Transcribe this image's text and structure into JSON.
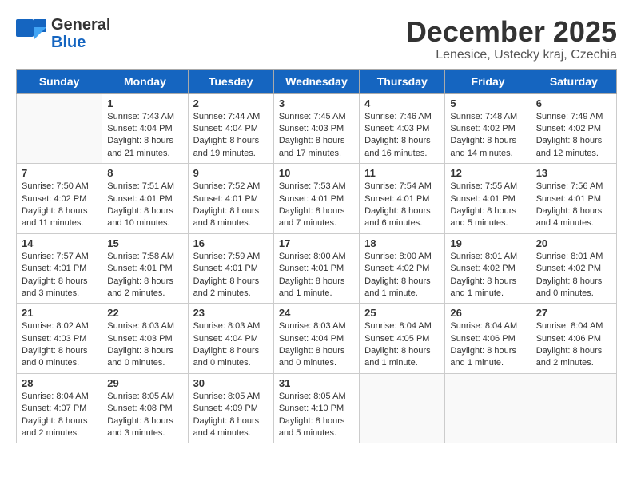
{
  "header": {
    "logo_general": "General",
    "logo_blue": "Blue",
    "month_title": "December 2025",
    "location": "Lenesice, Ustecky kraj, Czechia"
  },
  "weekdays": [
    "Sunday",
    "Monday",
    "Tuesday",
    "Wednesday",
    "Thursday",
    "Friday",
    "Saturday"
  ],
  "weeks": [
    [
      {
        "day": "",
        "content": ""
      },
      {
        "day": "1",
        "content": "Sunrise: 7:43 AM\nSunset: 4:04 PM\nDaylight: 8 hours\nand 21 minutes."
      },
      {
        "day": "2",
        "content": "Sunrise: 7:44 AM\nSunset: 4:04 PM\nDaylight: 8 hours\nand 19 minutes."
      },
      {
        "day": "3",
        "content": "Sunrise: 7:45 AM\nSunset: 4:03 PM\nDaylight: 8 hours\nand 17 minutes."
      },
      {
        "day": "4",
        "content": "Sunrise: 7:46 AM\nSunset: 4:03 PM\nDaylight: 8 hours\nand 16 minutes."
      },
      {
        "day": "5",
        "content": "Sunrise: 7:48 AM\nSunset: 4:02 PM\nDaylight: 8 hours\nand 14 minutes."
      },
      {
        "day": "6",
        "content": "Sunrise: 7:49 AM\nSunset: 4:02 PM\nDaylight: 8 hours\nand 12 minutes."
      }
    ],
    [
      {
        "day": "7",
        "content": "Sunrise: 7:50 AM\nSunset: 4:02 PM\nDaylight: 8 hours\nand 11 minutes."
      },
      {
        "day": "8",
        "content": "Sunrise: 7:51 AM\nSunset: 4:01 PM\nDaylight: 8 hours\nand 10 minutes."
      },
      {
        "day": "9",
        "content": "Sunrise: 7:52 AM\nSunset: 4:01 PM\nDaylight: 8 hours\nand 8 minutes."
      },
      {
        "day": "10",
        "content": "Sunrise: 7:53 AM\nSunset: 4:01 PM\nDaylight: 8 hours\nand 7 minutes."
      },
      {
        "day": "11",
        "content": "Sunrise: 7:54 AM\nSunset: 4:01 PM\nDaylight: 8 hours\nand 6 minutes."
      },
      {
        "day": "12",
        "content": "Sunrise: 7:55 AM\nSunset: 4:01 PM\nDaylight: 8 hours\nand 5 minutes."
      },
      {
        "day": "13",
        "content": "Sunrise: 7:56 AM\nSunset: 4:01 PM\nDaylight: 8 hours\nand 4 minutes."
      }
    ],
    [
      {
        "day": "14",
        "content": "Sunrise: 7:57 AM\nSunset: 4:01 PM\nDaylight: 8 hours\nand 3 minutes."
      },
      {
        "day": "15",
        "content": "Sunrise: 7:58 AM\nSunset: 4:01 PM\nDaylight: 8 hours\nand 2 minutes."
      },
      {
        "day": "16",
        "content": "Sunrise: 7:59 AM\nSunset: 4:01 PM\nDaylight: 8 hours\nand 2 minutes."
      },
      {
        "day": "17",
        "content": "Sunrise: 8:00 AM\nSunset: 4:01 PM\nDaylight: 8 hours\nand 1 minute."
      },
      {
        "day": "18",
        "content": "Sunrise: 8:00 AM\nSunset: 4:02 PM\nDaylight: 8 hours\nand 1 minute."
      },
      {
        "day": "19",
        "content": "Sunrise: 8:01 AM\nSunset: 4:02 PM\nDaylight: 8 hours\nand 1 minute."
      },
      {
        "day": "20",
        "content": "Sunrise: 8:01 AM\nSunset: 4:02 PM\nDaylight: 8 hours\nand 0 minutes."
      }
    ],
    [
      {
        "day": "21",
        "content": "Sunrise: 8:02 AM\nSunset: 4:03 PM\nDaylight: 8 hours\nand 0 minutes."
      },
      {
        "day": "22",
        "content": "Sunrise: 8:03 AM\nSunset: 4:03 PM\nDaylight: 8 hours\nand 0 minutes."
      },
      {
        "day": "23",
        "content": "Sunrise: 8:03 AM\nSunset: 4:04 PM\nDaylight: 8 hours\nand 0 minutes."
      },
      {
        "day": "24",
        "content": "Sunrise: 8:03 AM\nSunset: 4:04 PM\nDaylight: 8 hours\nand 0 minutes."
      },
      {
        "day": "25",
        "content": "Sunrise: 8:04 AM\nSunset: 4:05 PM\nDaylight: 8 hours\nand 1 minute."
      },
      {
        "day": "26",
        "content": "Sunrise: 8:04 AM\nSunset: 4:06 PM\nDaylight: 8 hours\nand 1 minute."
      },
      {
        "day": "27",
        "content": "Sunrise: 8:04 AM\nSunset: 4:06 PM\nDaylight: 8 hours\nand 2 minutes."
      }
    ],
    [
      {
        "day": "28",
        "content": "Sunrise: 8:04 AM\nSunset: 4:07 PM\nDaylight: 8 hours\nand 2 minutes."
      },
      {
        "day": "29",
        "content": "Sunrise: 8:05 AM\nSunset: 4:08 PM\nDaylight: 8 hours\nand 3 minutes."
      },
      {
        "day": "30",
        "content": "Sunrise: 8:05 AM\nSunset: 4:09 PM\nDaylight: 8 hours\nand 4 minutes."
      },
      {
        "day": "31",
        "content": "Sunrise: 8:05 AM\nSunset: 4:10 PM\nDaylight: 8 hours\nand 5 minutes."
      },
      {
        "day": "",
        "content": ""
      },
      {
        "day": "",
        "content": ""
      },
      {
        "day": "",
        "content": ""
      }
    ]
  ]
}
